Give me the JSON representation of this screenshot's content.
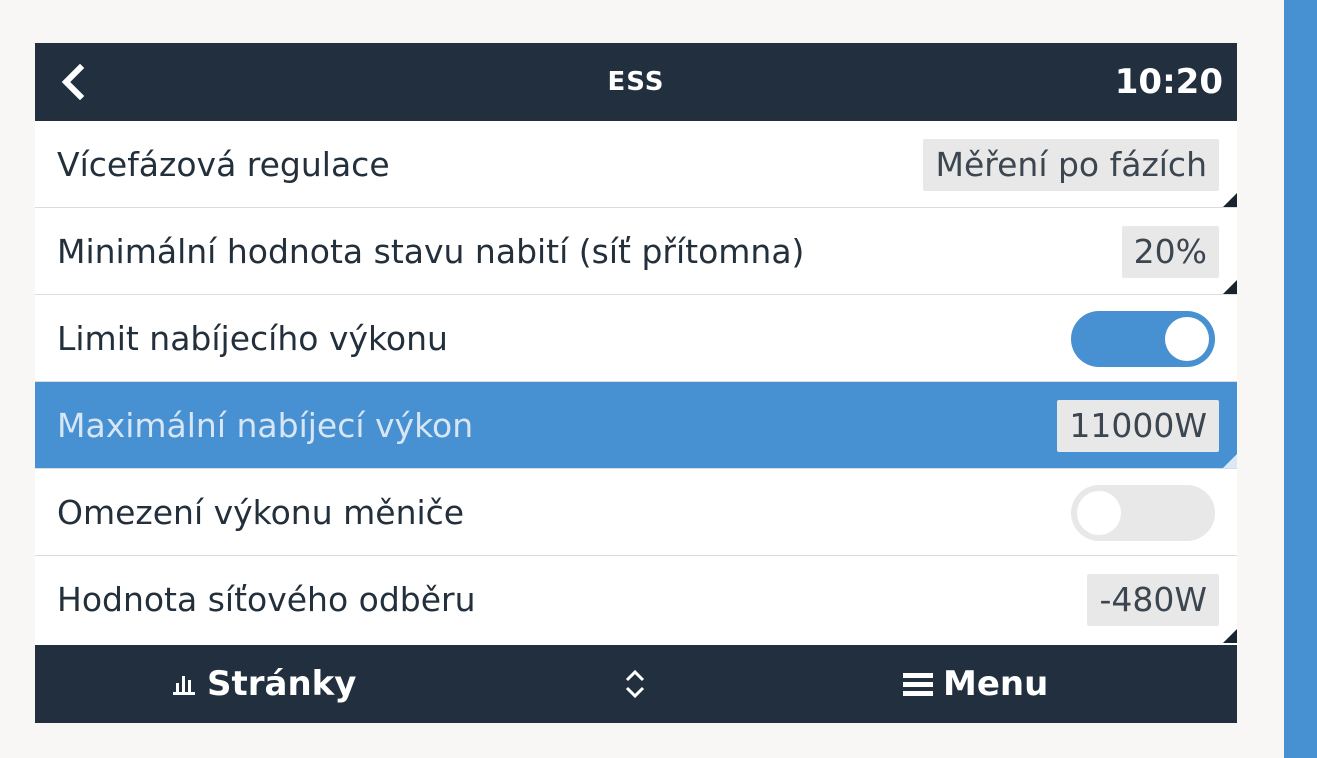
{
  "header": {
    "title": "ESS",
    "time": "10:20",
    "back_icon": "chevron-left-icon"
  },
  "settings": [
    {
      "label": "Vícefázová regulace",
      "type": "value",
      "value": "Měření po fázích"
    },
    {
      "label": "Minimální hodnota stavu nabití (síť přítomna)",
      "type": "value",
      "value": "20%"
    },
    {
      "label": "Limit nabíjecího výkonu",
      "type": "toggle",
      "state": "on"
    },
    {
      "label": "Maximální nabíjecí výkon",
      "type": "value",
      "value": "11000W",
      "selected": true
    },
    {
      "label": "Omezení výkonu měniče",
      "type": "toggle",
      "state": "off"
    },
    {
      "label": "Hodnota síťového odběru",
      "type": "value",
      "value": "-480W"
    }
  ],
  "footer": {
    "pages_label": "Stránky",
    "pages_icon": "bar-chart-icon",
    "updown_icon": "up-down-chevron-icon",
    "menu_label": "Menu",
    "menu_icon": "hamburger-menu-icon"
  },
  "colors": {
    "header_bg": "#222f3e",
    "accent": "#4790d2",
    "value_box_bg": "#e8e8e8",
    "page_bg": "#f8f7f5"
  }
}
